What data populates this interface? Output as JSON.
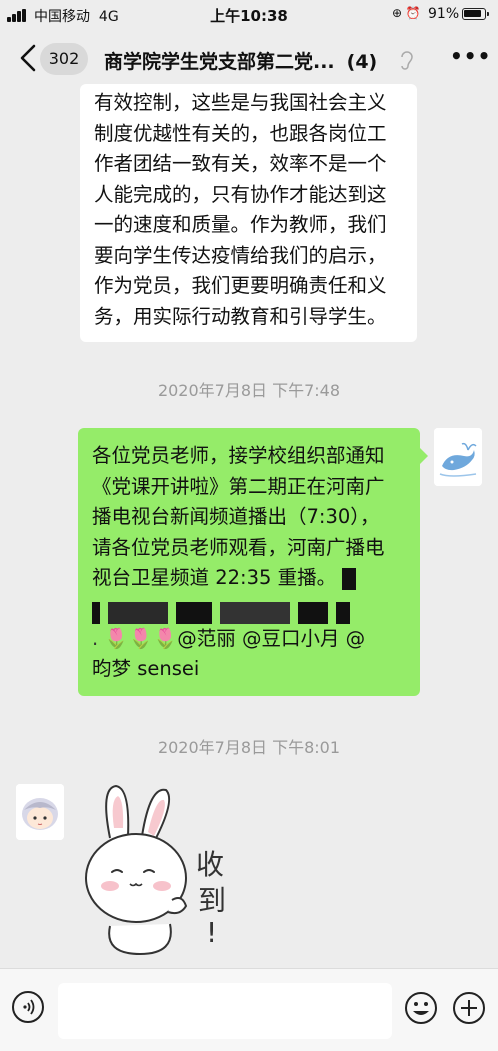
{
  "status_bar": {
    "carrier": "中国移动",
    "network": "4G",
    "time": "上午10:38",
    "battery": "91%",
    "battery_level": 0.91
  },
  "nav": {
    "unread_count": "302",
    "title": "商学院学生党支部第二党...",
    "member_count": "(4)"
  },
  "messages": [
    {
      "type": "text",
      "side": "left",
      "lines": [
        "有效控制，这些是与我国社会主义",
        "制度优越性有关的，也跟各岗位工",
        "作者团结一致有关，效率不是一个",
        "人能完成的，只有协作才能达到这",
        "一的速度和质量。作为教师，我们",
        "要向学生传达疫情给我们的启示，",
        "作为党员，我们更要明确责任和义",
        "务，用实际行动教育和引导学生。"
      ]
    },
    {
      "type": "timestamp",
      "text": "2020年7月8日 下午7:48"
    },
    {
      "type": "text",
      "side": "right",
      "lines": [
        "各位党员老师，接学校组织部通知",
        "《党课开讲啦》第二期正在河南广",
        "播电视台新闻频道播出（7:30），",
        "请各位党员老师观看，河南广播电",
        "视台卫星频道 22:35 重播。"
      ],
      "mentions_line_1": "@范丽 @豆口小月 @",
      "mentions_line_2": "昀梦 sensei",
      "emoji": "🌷🌷🌷"
    },
    {
      "type": "timestamp",
      "text": "2020年7月8日 下午8:01"
    },
    {
      "type": "sticker",
      "side": "left",
      "text": "收到!"
    }
  ]
}
